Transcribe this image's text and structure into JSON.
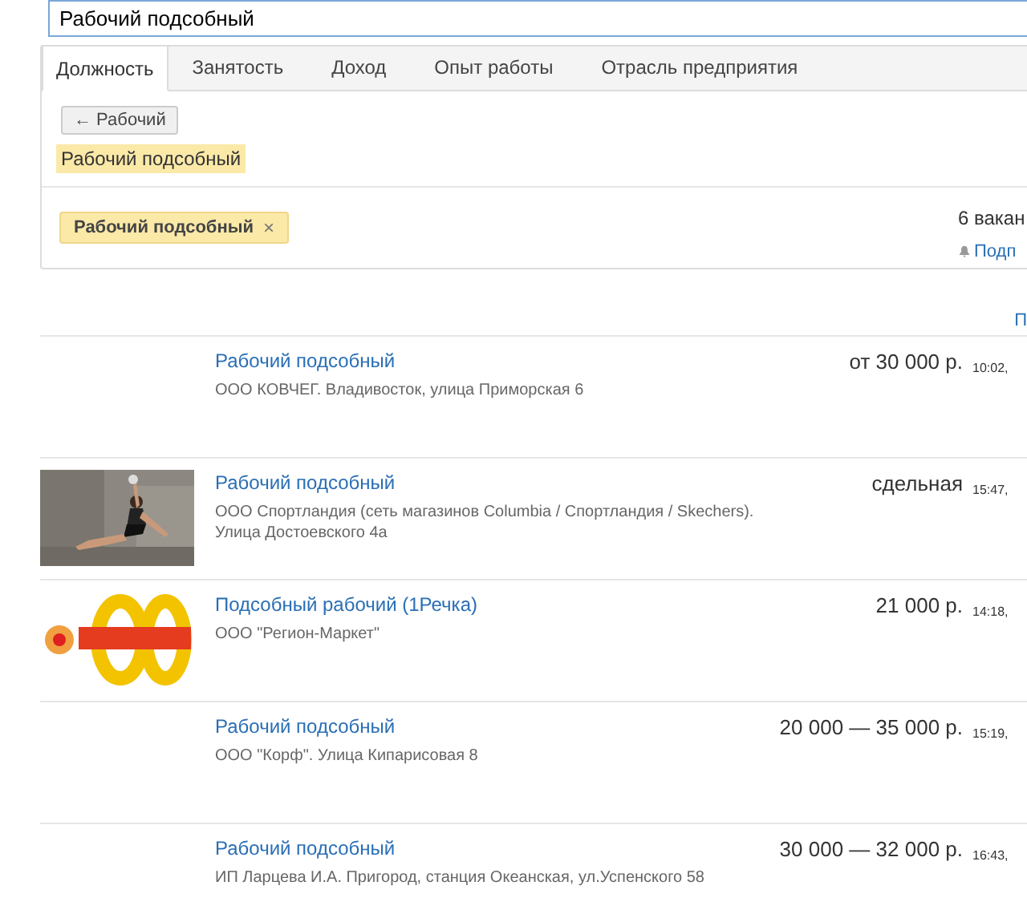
{
  "search": {
    "value": "Рабочий подсобный"
  },
  "tabs": [
    {
      "label": "Должность",
      "selected": true
    },
    {
      "label": "Занятость",
      "selected": false
    },
    {
      "label": "Доход",
      "selected": false
    },
    {
      "label": "Опыт работы",
      "selected": false
    },
    {
      "label": "Отрасль предприятия",
      "selected": false
    }
  ],
  "back_button": {
    "label": "← Рабочий"
  },
  "highlighted_term": "Рабочий подсобный",
  "filter_chip": {
    "label": "Рабочий подсобный",
    "remove": "×"
  },
  "results_count": "6 вакан",
  "subscribe_link": "Подп",
  "sort_link": "П",
  "vacancies": [
    {
      "kind": "plain",
      "title": "Рабочий подсобный",
      "employer": "ООО КОВЧЕГ. Владивосток, улица Приморская 6",
      "salary": "от 30 000 р.",
      "time": "10:02,"
    },
    {
      "title": "Рабочий подсобный",
      "employer": "ООО Спортландия (сеть магазинов Columbia / Спортландия / Skechers). Улица Достоевского 4а",
      "salary": "сдельная",
      "time": "15:47,"
    },
    {
      "kind": "logo",
      "title": "Подсобный рабочий (1Речка)",
      "employer": "ООО \"Регион-Маркет\"",
      "salary": "21 000 р.",
      "time": "14:18,"
    },
    {
      "kind": "plain",
      "title": "Рабочий подсобный",
      "employer": "ООО \"Корф\". Улица Кипарисовая 8",
      "salary": "20 000 — 35 000 р.",
      "time": "15:19,"
    },
    {
      "kind": "plain",
      "title": "Рабочий подсобный",
      "employer": "ИП Ларцева И.А. Пригород, станция Океанская, ул.Успенского 58",
      "salary": "30 000 — 32 000 р.",
      "time": "16:43,"
    }
  ]
}
